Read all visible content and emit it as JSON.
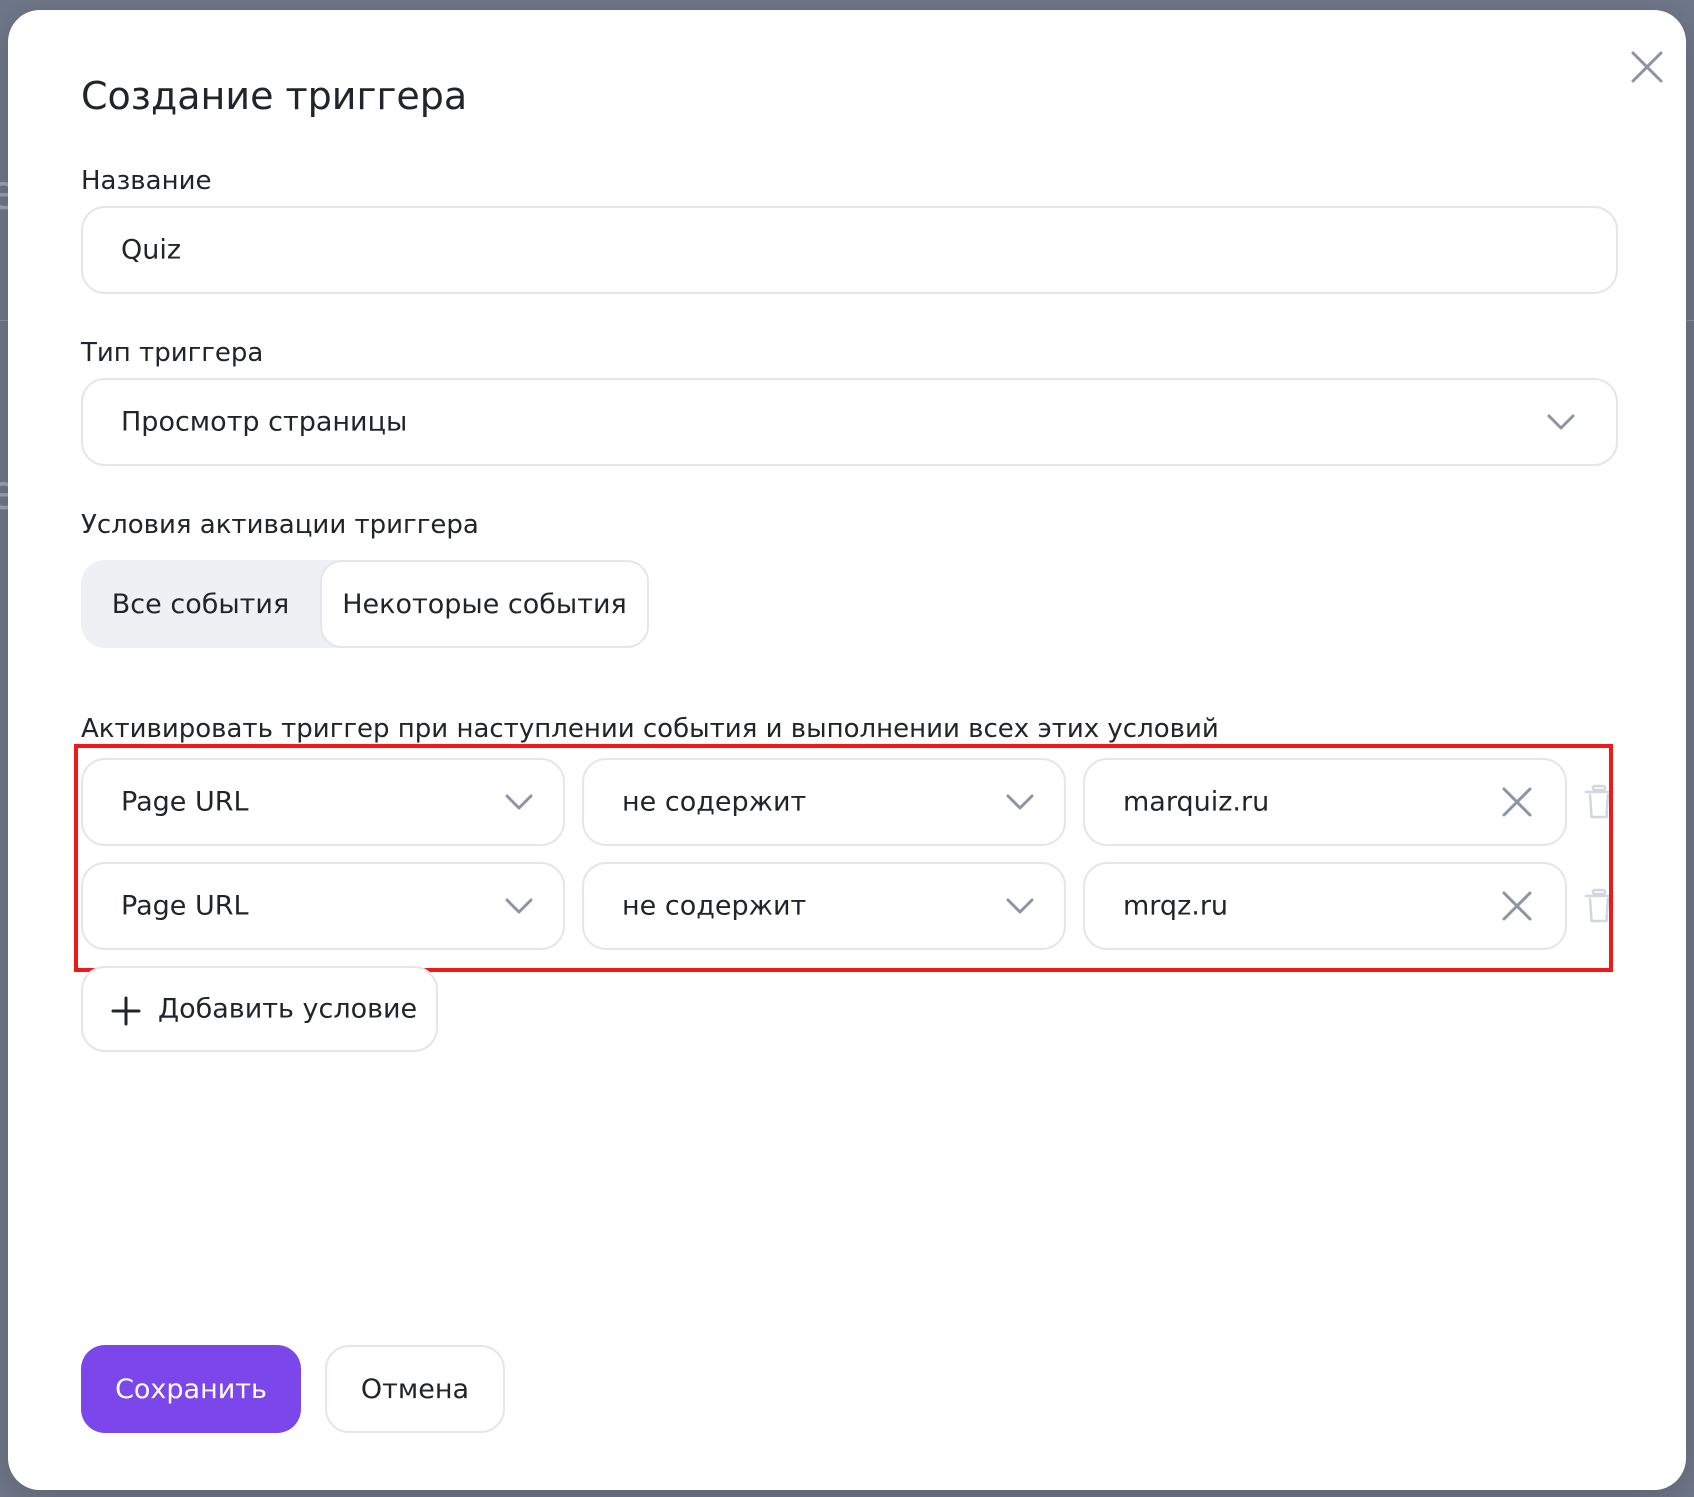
{
  "modal": {
    "title": "Создание триггера",
    "close_icon": "close-icon"
  },
  "name_field": {
    "label": "Название",
    "value": "Quiz"
  },
  "trigger_type": {
    "label": "Тип триггера",
    "value": "Просмотр страницы",
    "icon": "chevron-down-icon"
  },
  "activation": {
    "label": "Условия активации триггера",
    "options": [
      "Все события",
      "Некоторые события"
    ],
    "selected": "Некоторые события"
  },
  "conditions": {
    "heading": "Активировать триггер при наступлении события и выполнении всех этих условий",
    "rows": [
      {
        "variable": "Page URL",
        "operator": "не содержит",
        "value": "marquiz.ru"
      },
      {
        "variable": "Page URL",
        "operator": "не содержит",
        "value": "mrqz.ru"
      }
    ],
    "highlight_color": "#f11818"
  },
  "add_condition": {
    "label": "Добавить условие",
    "icon": "plus-icon"
  },
  "footer": {
    "save_label": "Сохранить",
    "cancel_label": "Отмена",
    "accent_color": "#7b46ea"
  }
}
